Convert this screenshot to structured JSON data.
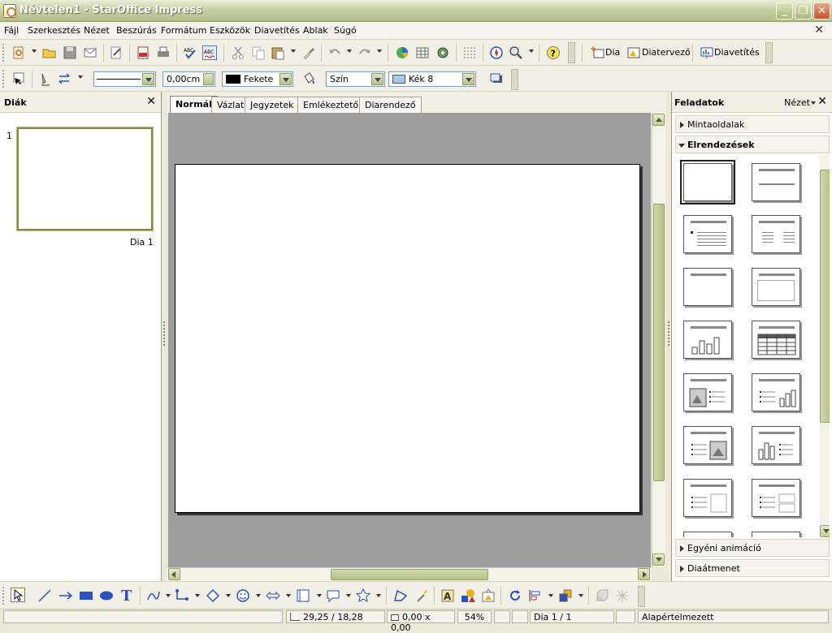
{
  "window": {
    "title": "Névtelen1 - StarOffice Impress",
    "minimize_icon": "minimize-icon",
    "maximize_icon": "restore-icon",
    "close_icon": "close-icon"
  },
  "menu": {
    "items": [
      "Fájl",
      "Szerkesztés",
      "Nézet",
      "Beszúrás",
      "Formátum",
      "Eszközök",
      "Diavetítés",
      "Ablak",
      "Súgó"
    ],
    "close_glyph": "✕"
  },
  "toolbar_standard": {
    "slide_label": "Dia",
    "design_label": "Diatervező",
    "show_label": "Diavetítés"
  },
  "toolbar_line": {
    "line_width": "0,00cm",
    "line_color": "Fekete",
    "line_color_hex": "#000000",
    "area_style": "Szín",
    "area_color": "Kék 8",
    "area_color_hex": "#a4c8f0"
  },
  "slides_panel": {
    "title": "Diák",
    "close_glyph": "✕",
    "slides": [
      {
        "number": "1",
        "label": "Dia 1"
      }
    ]
  },
  "view_tabs": [
    "Normál",
    "Vázlat",
    "Jegyzetek",
    "Emlékeztető",
    "Diarendező"
  ],
  "task_panel": {
    "title": "Feladatok",
    "view_label": "Nézet",
    "close_glyph": "✕",
    "sections": {
      "master_pages": "Mintaoldalak",
      "layouts": "Elrendezések",
      "custom_animation": "Egyéni animáció",
      "transition": "Diaátmenet"
    }
  },
  "status": {
    "position": "29,25 / 18,28",
    "size": "0,00 x 0,00",
    "zoom": "54%",
    "slide": "Dia 1 / 1",
    "style": "Alapértelmezett"
  },
  "colors": {
    "titlebar_accent": "#b4bf8e",
    "selection_olive": "#7a8a4a",
    "canvas_gray": "#9e9e9e"
  }
}
